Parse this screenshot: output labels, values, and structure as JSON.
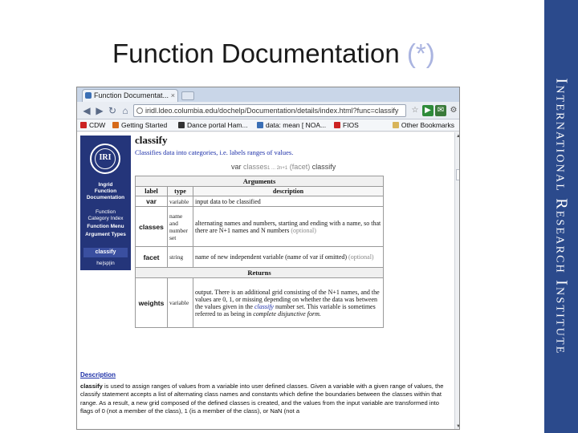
{
  "slide": {
    "title": "Function Documentation",
    "title_marker": "(*)",
    "brand_vertical": "International Research Institute"
  },
  "browser": {
    "tab_title": "Function Documentat...",
    "tab_close": "×",
    "url": "iridl.ldeo.columbia.edu/dochelp/Documentation/details/index.html?func=classify",
    "nav": {
      "back": "◀",
      "forward": "▶",
      "reload": "↻",
      "home": "⌂"
    },
    "toolbar_icons": [
      "☆",
      "▶",
      "✉",
      "⚙"
    ],
    "bookmarks": [
      "CDW",
      "Getting Started",
      "Dance portal Ham...",
      "data: mean [ NOA...",
      "FIOS"
    ],
    "other_bookmarks": "Other Bookmarks"
  },
  "sidebar": {
    "logo_text": "IRI",
    "line1": "Ingrid",
    "line2": "Function",
    "line3": "Documentation",
    "link1": "Function",
    "link2": "Category Index",
    "link3": "Function Menu",
    "link4": "Argument Types",
    "active": "classify",
    "lang": "he|sp|in"
  },
  "doc": {
    "name": "classify",
    "summary": "Classifies data into categories, i.e. labels ranges of values.",
    "signature": {
      "var": "var",
      "classes": "classes",
      "sub": "1 ... 2n+1",
      "label": "(facet)",
      "fn": "classify"
    },
    "arguments_header": "Arguments",
    "col_label": "label",
    "col_type": "type",
    "col_desc": "description",
    "args": [
      {
        "label": "var",
        "type": "variable",
        "desc": "input data to be classified",
        "opt": ""
      },
      {
        "label": "classes",
        "type": "name and number set",
        "desc": "alternating names and numbers, starting and ending with a name, so that there are N+1 names and N numbers",
        "opt": "(optional)"
      },
      {
        "label": "facet",
        "type": "string",
        "desc": "name of new independent variable (name of var if omitted)",
        "opt": "(optional)"
      }
    ],
    "returns_header": "Returns",
    "returns": {
      "label": "weights",
      "type": "variable",
      "desc_a": "output. There is an additional grid consisting of the N+1 names, and the values are 0, 1, or missing depending on whether the data was between the values given in the",
      "desc_link": "classify",
      "desc_b": "number set. This variable is sometimes referred to as being in",
      "desc_it": "complete disjunctive form."
    },
    "description_head": "Description",
    "description_name": "classify",
    "description_text": "is used to assign ranges of values from a variable into user defined classes. Given a variable with a given range of values, the classify statement accepts a list of alternating class names and constants which define the boundaries between the classes within that range. As a result, a new grid composed of the defined classes is created, and the values from the input variable are transformed into flags of 0 (not a member of the class), 1 (is a member of the class), or NaN (not a"
  }
}
